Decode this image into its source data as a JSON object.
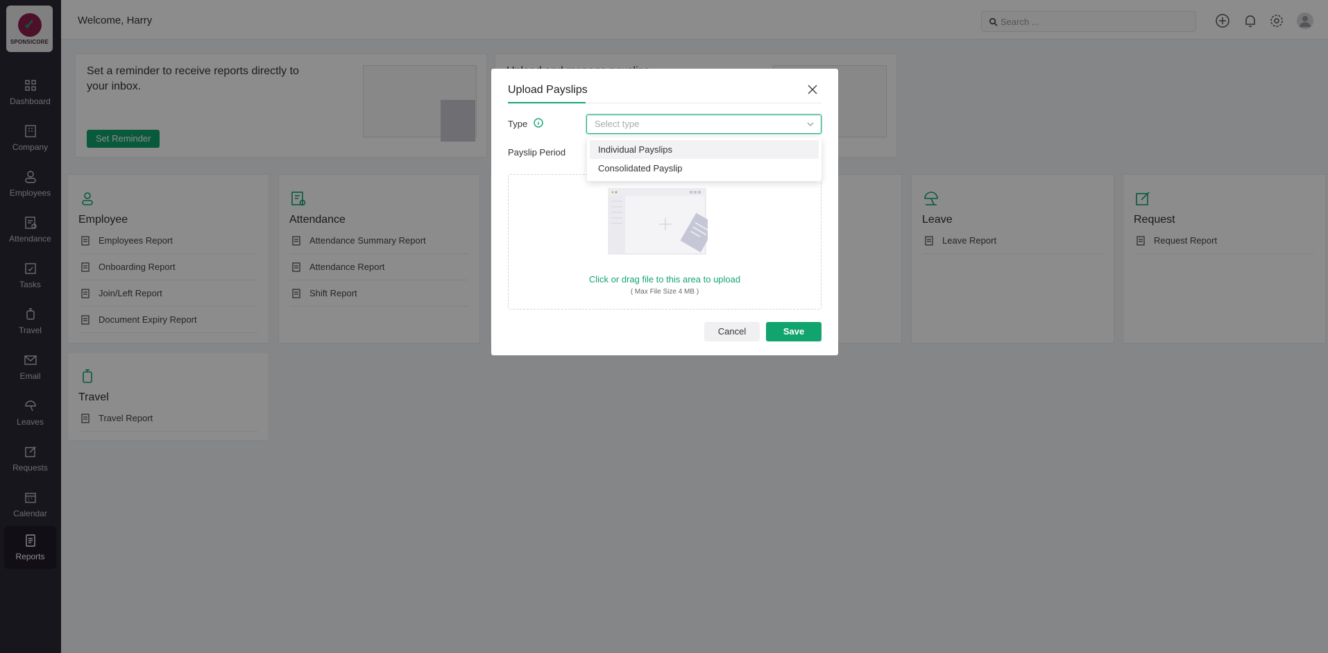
{
  "brand": {
    "logo_text": "SPONSICORE",
    "accent": "#12a46f",
    "logo_color": "#8a2049"
  },
  "sidebar": {
    "items": [
      {
        "label": "Dashboard",
        "icon": "grid-icon"
      },
      {
        "label": "Company",
        "icon": "building-icon"
      },
      {
        "label": "Employees",
        "icon": "user-icon"
      },
      {
        "label": "Attendance",
        "icon": "clipboard-check-icon"
      },
      {
        "label": "Tasks",
        "icon": "task-icon"
      },
      {
        "label": "Travel",
        "icon": "luggage-icon"
      },
      {
        "label": "Email",
        "icon": "mail-icon"
      },
      {
        "label": "Leaves",
        "icon": "umbrella-icon"
      },
      {
        "label": "Requests",
        "icon": "edit-icon"
      },
      {
        "label": "Calendar",
        "icon": "calendar-icon"
      },
      {
        "label": "Reports",
        "icon": "report-icon",
        "active": true
      }
    ]
  },
  "header": {
    "welcome": "Welcome, Harry",
    "search_placeholder": "Search ..."
  },
  "banners": [
    {
      "text": "Set a reminder to receive reports directly to your inbox.",
      "button": "Set Reminder"
    },
    {
      "text": "Upload and manage payslips"
    }
  ],
  "cards": [
    {
      "title": "Employee",
      "rows": [
        "Employees Report",
        "Onboarding Report",
        "Join/Left Report",
        "Document Expiry Report"
      ]
    },
    {
      "title": "Attendance",
      "rows": [
        "Attendance Summary Report",
        "Attendance Report",
        "Shift Report"
      ]
    },
    {
      "title": "Leave",
      "rows": [
        "Leave Report"
      ]
    },
    {
      "title": "Request",
      "rows": [
        "Request Report"
      ]
    },
    {
      "title": "Travel",
      "rows": [
        "Travel Report"
      ]
    }
  ],
  "modal": {
    "title": "Upload Payslips",
    "type_label": "Type",
    "type_placeholder": "Select type",
    "period_label": "Payslip Period",
    "options": [
      "Individual Payslips",
      "Consolidated Payslip"
    ],
    "upload_text": "Click or drag file to this area to upload",
    "upload_sub": "( Max File Size 4 MB )",
    "cancel": "Cancel",
    "save": "Save"
  }
}
